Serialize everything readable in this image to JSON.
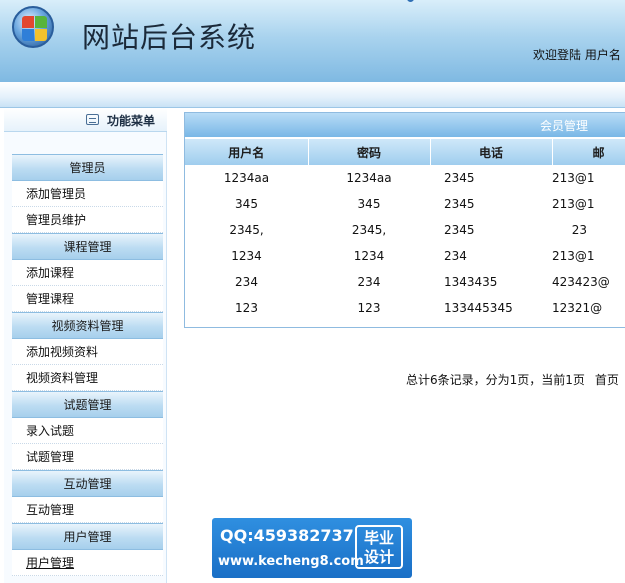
{
  "header": {
    "site_title": "网站后台系统",
    "welcome": "欢迎登陆 用户名"
  },
  "sidebar": {
    "title": "功能菜单",
    "groups": [
      {
        "title": "管理员",
        "items": [
          "添加管理员",
          "管理员维护"
        ]
      },
      {
        "title": "课程管理",
        "items": [
          "添加课程",
          "管理课程"
        ]
      },
      {
        "title": "视频资料管理",
        "items": [
          "添加视频资料",
          "视频资料管理"
        ]
      },
      {
        "title": "试题管理",
        "items": [
          "录入试题",
          "试题管理"
        ]
      },
      {
        "title": "互动管理",
        "items": [
          "互动管理"
        ]
      },
      {
        "title": "用户管理",
        "items": [
          "用户管理"
        ]
      }
    ]
  },
  "panel": {
    "title": "会员管理",
    "columns": [
      "用户名",
      "密码",
      "电话",
      "邮"
    ],
    "rows": [
      [
        "1234aa",
        "1234aa",
        "2345",
        "213@1"
      ],
      [
        "345",
        "345",
        "2345",
        "213@1"
      ],
      [
        "2345,",
        "2345,",
        "2345",
        "23"
      ],
      [
        "1234",
        "1234",
        "234",
        "213@1"
      ],
      [
        "234",
        "234",
        "1343435",
        "423423@"
      ],
      [
        "123",
        "123",
        "133445345",
        "12321@"
      ]
    ]
  },
  "pager": {
    "summary": "总计6条记录，分为1页，当前1页",
    "first": "首页"
  },
  "watermark": {
    "qq": "QQ:459382737",
    "site": "www.kecheng8.com",
    "badge_line1": "毕业",
    "badge_line2": "设计"
  }
}
